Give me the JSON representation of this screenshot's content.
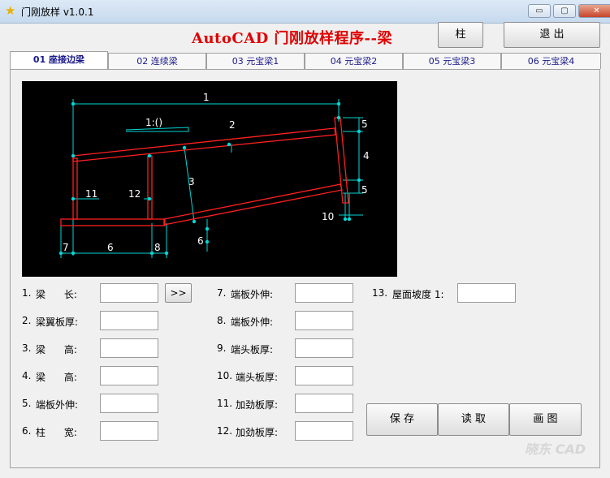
{
  "window": {
    "title": "门刚放样 v1.0.1",
    "minimize": "▭",
    "maximize": "▢",
    "close": "✕"
  },
  "header": {
    "title": "AutoCAD 门刚放样程序--梁",
    "column_button": "柱",
    "exit_button": "退 出"
  },
  "tabs": [
    "01 座接边梁",
    "02 连续梁",
    "03 元宝梁1",
    "04 元宝梁2",
    "05 元宝梁3",
    "06 元宝梁4"
  ],
  "drawing": {
    "labels": [
      "1",
      "1:()",
      "2",
      "3",
      "4",
      "5",
      "5",
      "6",
      "6",
      "7",
      "8",
      "10",
      "11",
      "12"
    ]
  },
  "fields_left": [
    {
      "num": "1.",
      "label": "梁      长:",
      "value": ""
    },
    {
      "num": "2.",
      "label": "梁翼板厚:",
      "value": ""
    },
    {
      "num": "3.",
      "label": "梁      高:",
      "value": ""
    },
    {
      "num": "4.",
      "label": "梁      高:",
      "value": ""
    },
    {
      "num": "5.",
      "label": "端板外伸:",
      "value": ""
    },
    {
      "num": "6.",
      "label": "柱      宽:",
      "value": ""
    }
  ],
  "fields_mid": [
    {
      "num": "7.",
      "label": "端板外伸:",
      "value": ""
    },
    {
      "num": "8.",
      "label": "端板外伸:",
      "value": ""
    },
    {
      "num": "9.",
      "label": "端头板厚:",
      "value": ""
    },
    {
      "num": "10.",
      "label": "端头板厚:",
      "value": ""
    },
    {
      "num": "11.",
      "label": "加劲板厚:",
      "value": ""
    },
    {
      "num": "12.",
      "label": "加劲板厚:",
      "value": ""
    }
  ],
  "field_slope": {
    "num": "13.",
    "label": "屋面坡度 1:",
    "value": ""
  },
  "arrow_button": ">>",
  "actions": {
    "save": "保 存",
    "read": "读 取",
    "draw": "画 图"
  },
  "watermark": "晓东 CAD"
}
